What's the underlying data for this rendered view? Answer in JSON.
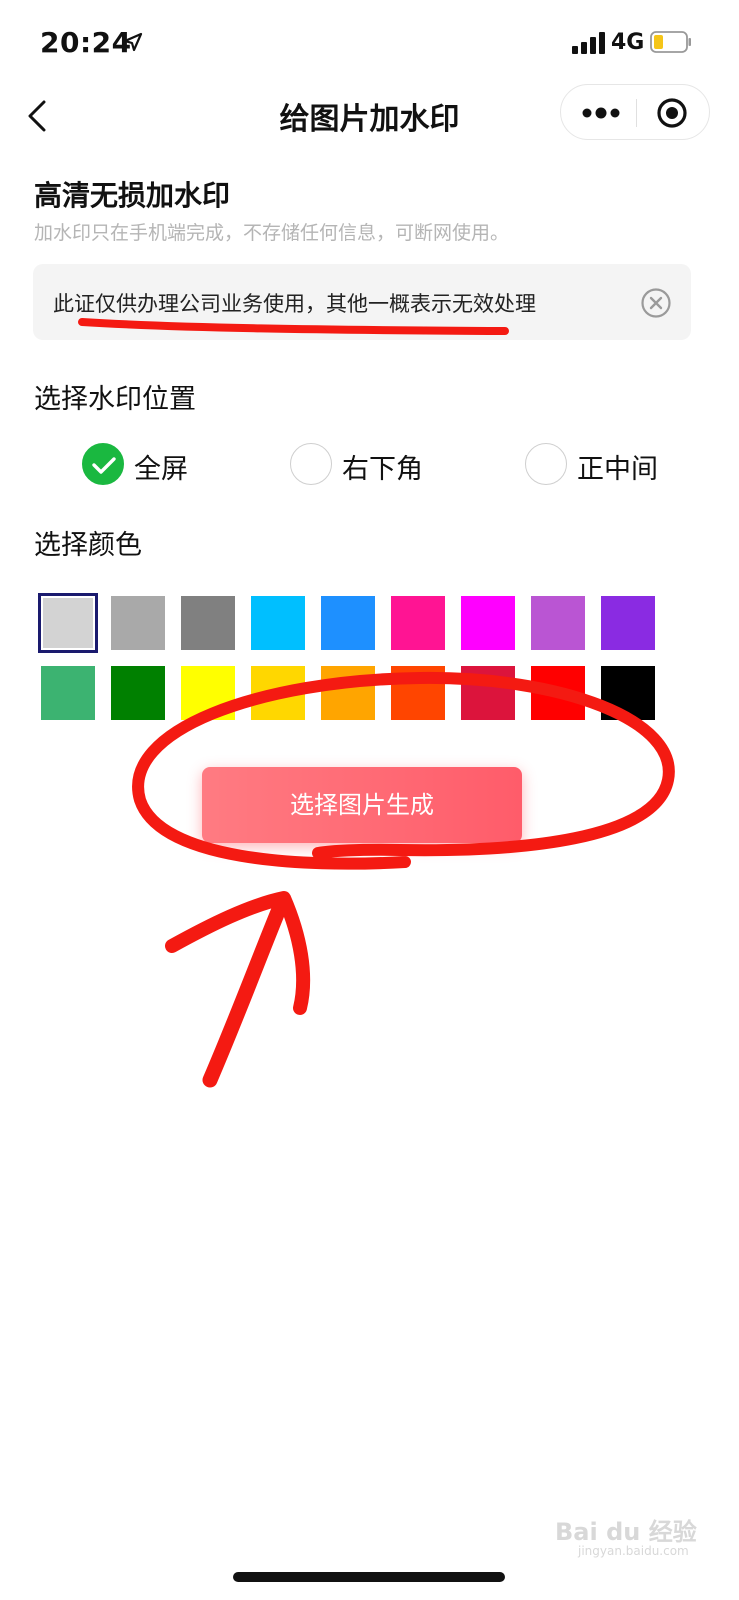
{
  "status_bar": {
    "time": "20:24",
    "network": "4G"
  },
  "nav": {
    "title": "给图片加水印"
  },
  "header": {
    "title": "高清无损加水印",
    "subtitle": "加水印只在手机端完成，不存储任何信息，可断网使用。"
  },
  "watermark_input": {
    "value": "此证仅供办理公司业务使用，其他一概表示无效处理"
  },
  "position": {
    "title": "选择水印位置",
    "options": [
      {
        "label": "全屏",
        "selected": true
      },
      {
        "label": "右下角",
        "selected": false
      },
      {
        "label": "正中间",
        "selected": false
      }
    ]
  },
  "color": {
    "title": "选择颜色",
    "selected_index": 0,
    "swatches": [
      "#d3d3d3",
      "#a9a9a9",
      "#808080",
      "#00bfff",
      "#1e90ff",
      "#ff1493",
      "#ff00ff",
      "#ba55d3",
      "#8a2be2",
      "#3cb371",
      "#008000",
      "#ffff00",
      "#ffd700",
      "#ffa500",
      "#ff4500",
      "#dc143c",
      "#ff0000",
      "#000000"
    ]
  },
  "generate_button": {
    "label": "选择图片生成"
  },
  "watermark_logo": {
    "text": "Bai du 经验",
    "sub": "jingyan.baidu.com"
  }
}
